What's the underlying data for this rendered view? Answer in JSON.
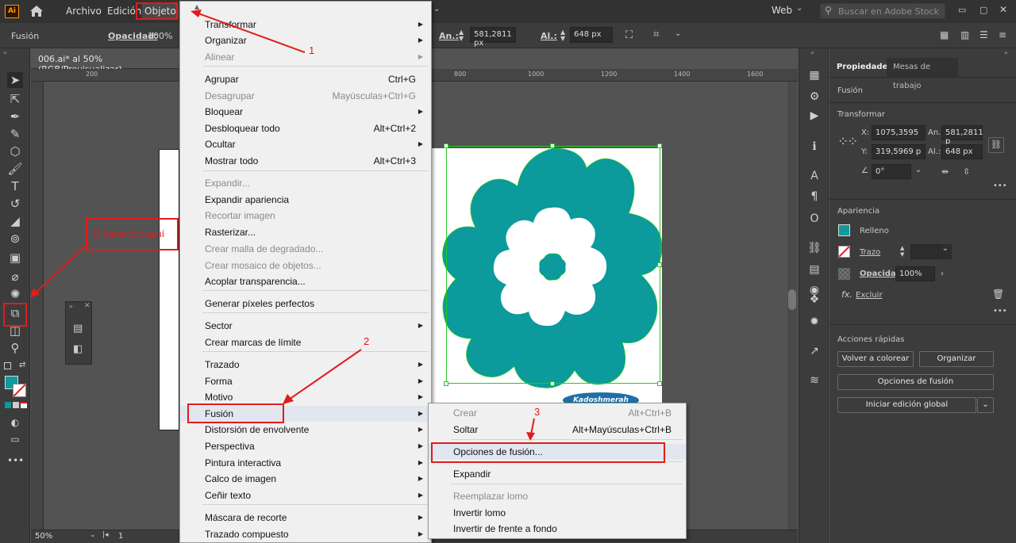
{
  "menubar": {
    "app_icon": "Ai",
    "items": [
      "Archivo",
      "Edición",
      "Objeto"
    ],
    "workspace": "Web",
    "search_placeholder": "Buscar en Adobe Stock"
  },
  "controlbar": {
    "selection_label": "Fusión",
    "opacity_label": "Opacidad:",
    "opacity_value": "100%",
    "width_label": "An.:",
    "width_value": "581,2811 px",
    "height_label": "Al.:",
    "height_value": "648 px"
  },
  "document": {
    "tab_title": "006.ai* al 50% (RGB/Previsualizar)",
    "zoom": "50%",
    "artboard_number": "1",
    "ruler_ticks": [
      "200",
      "800",
      "1000",
      "1200",
      "1400",
      "1600"
    ],
    "watermark": "Kadoshmerah"
  },
  "colors": {
    "shape_fill": "#0c9a9c",
    "annotation": "#e21b1b",
    "panel_bg": "#3c3c3c",
    "menu_bg": "#f0f0f0",
    "selection": "#26c726"
  },
  "main_menu": {
    "items": [
      {
        "label": "Transformar",
        "shortcut": "",
        "submenu": true,
        "disabled": false
      },
      {
        "label": "Organizar",
        "shortcut": "",
        "submenu": true,
        "disabled": false
      },
      {
        "label": "Alinear",
        "shortcut": "",
        "submenu": true,
        "disabled": true
      },
      {
        "label": "Agrupar",
        "shortcut": "Ctrl+G",
        "submenu": false,
        "disabled": false
      },
      {
        "label": "Desagrupar",
        "shortcut": "Mayúsculas+Ctrl+G",
        "submenu": false,
        "disabled": true
      },
      {
        "label": "Bloquear",
        "shortcut": "",
        "submenu": true,
        "disabled": false
      },
      {
        "label": "Desbloquear todo",
        "shortcut": "Alt+Ctrl+2",
        "submenu": false,
        "disabled": false
      },
      {
        "label": "Ocultar",
        "shortcut": "",
        "submenu": true,
        "disabled": false
      },
      {
        "label": "Mostrar todo",
        "shortcut": "Alt+Ctrl+3",
        "submenu": false,
        "disabled": false
      },
      {
        "label": "Expandir...",
        "shortcut": "",
        "submenu": false,
        "disabled": true
      },
      {
        "label": "Expandir apariencia",
        "shortcut": "",
        "submenu": false,
        "disabled": false
      },
      {
        "label": "Recortar imagen",
        "shortcut": "",
        "submenu": false,
        "disabled": true
      },
      {
        "label": "Rasterizar...",
        "shortcut": "",
        "submenu": false,
        "disabled": false
      },
      {
        "label": "Crear malla de degradado...",
        "shortcut": "",
        "submenu": false,
        "disabled": true
      },
      {
        "label": "Crear mosaico de objetos...",
        "shortcut": "",
        "submenu": false,
        "disabled": true
      },
      {
        "label": "Acoplar transparencia...",
        "shortcut": "",
        "submenu": false,
        "disabled": false
      },
      {
        "label": "Generar píxeles perfectos",
        "shortcut": "",
        "submenu": false,
        "disabled": false
      },
      {
        "label": "Sector",
        "shortcut": "",
        "submenu": true,
        "disabled": false
      },
      {
        "label": "Crear marcas de límite",
        "shortcut": "",
        "submenu": false,
        "disabled": false
      },
      {
        "label": "Trazado",
        "shortcut": "",
        "submenu": true,
        "disabled": false
      },
      {
        "label": "Forma",
        "shortcut": "",
        "submenu": true,
        "disabled": false
      },
      {
        "label": "Motivo",
        "shortcut": "",
        "submenu": true,
        "disabled": false
      },
      {
        "label": "Fusión",
        "shortcut": "",
        "submenu": true,
        "disabled": false
      },
      {
        "label": "Distorsión de envolvente",
        "shortcut": "",
        "submenu": true,
        "disabled": false
      },
      {
        "label": "Perspectiva",
        "shortcut": "",
        "submenu": true,
        "disabled": false
      },
      {
        "label": "Pintura interactiva",
        "shortcut": "",
        "submenu": true,
        "disabled": false
      },
      {
        "label": "Calco de imagen",
        "shortcut": "",
        "submenu": true,
        "disabled": false
      },
      {
        "label": "Ceñir texto",
        "shortcut": "",
        "submenu": true,
        "disabled": false
      },
      {
        "label": "Máscara de recorte",
        "shortcut": "",
        "submenu": true,
        "disabled": false
      },
      {
        "label": "Trazado compuesto",
        "shortcut": "",
        "submenu": true,
        "disabled": false
      }
    ]
  },
  "fusion_submenu": {
    "items": [
      {
        "label": "Crear",
        "shortcut": "Alt+Ctrl+B",
        "disabled": true
      },
      {
        "label": "Soltar",
        "shortcut": "Alt+Mayúsculas+Ctrl+B",
        "disabled": false
      },
      {
        "label": "Opciones de fusión...",
        "shortcut": "",
        "disabled": false
      },
      {
        "label": "Expandir",
        "shortcut": "",
        "disabled": false
      },
      {
        "label": "Reemplazar lomo",
        "shortcut": "",
        "disabled": true
      },
      {
        "label": "Invertir lomo",
        "shortcut": "",
        "disabled": false
      },
      {
        "label": "Invertir de frente a fondo",
        "shortcut": "",
        "disabled": false
      }
    ]
  },
  "annotations": {
    "step1": "1",
    "step2": "2",
    "step3": "3",
    "click_here": "O hacer clic aquí"
  },
  "properties": {
    "tab_properties": "Propiedades",
    "tab_artboards": "Mesas de trabajo",
    "object_type": "Fusión",
    "transform_title": "Transformar",
    "x_label": "X:",
    "x_value": "1075,3595",
    "y_label": "Y:",
    "y_value": "319,5969 p",
    "w_label": "An.:",
    "w_value": "581,2811 p",
    "h_label": "Al.:",
    "h_value": "648 px",
    "angle_value": "0°",
    "appearance_title": "Apariencia",
    "fill_label": "Relleno",
    "stroke_label": "Trazo",
    "opacity_label": "Opacidad",
    "opacity_value": "100%",
    "fx_label": "Excluir",
    "quick_actions_title": "Acciones rápidas",
    "btn_recolor": "Volver a colorear",
    "btn_arrange": "Organizar",
    "btn_blend_options": "Opciones de fusión",
    "btn_global_edit": "Iniciar edición global"
  }
}
